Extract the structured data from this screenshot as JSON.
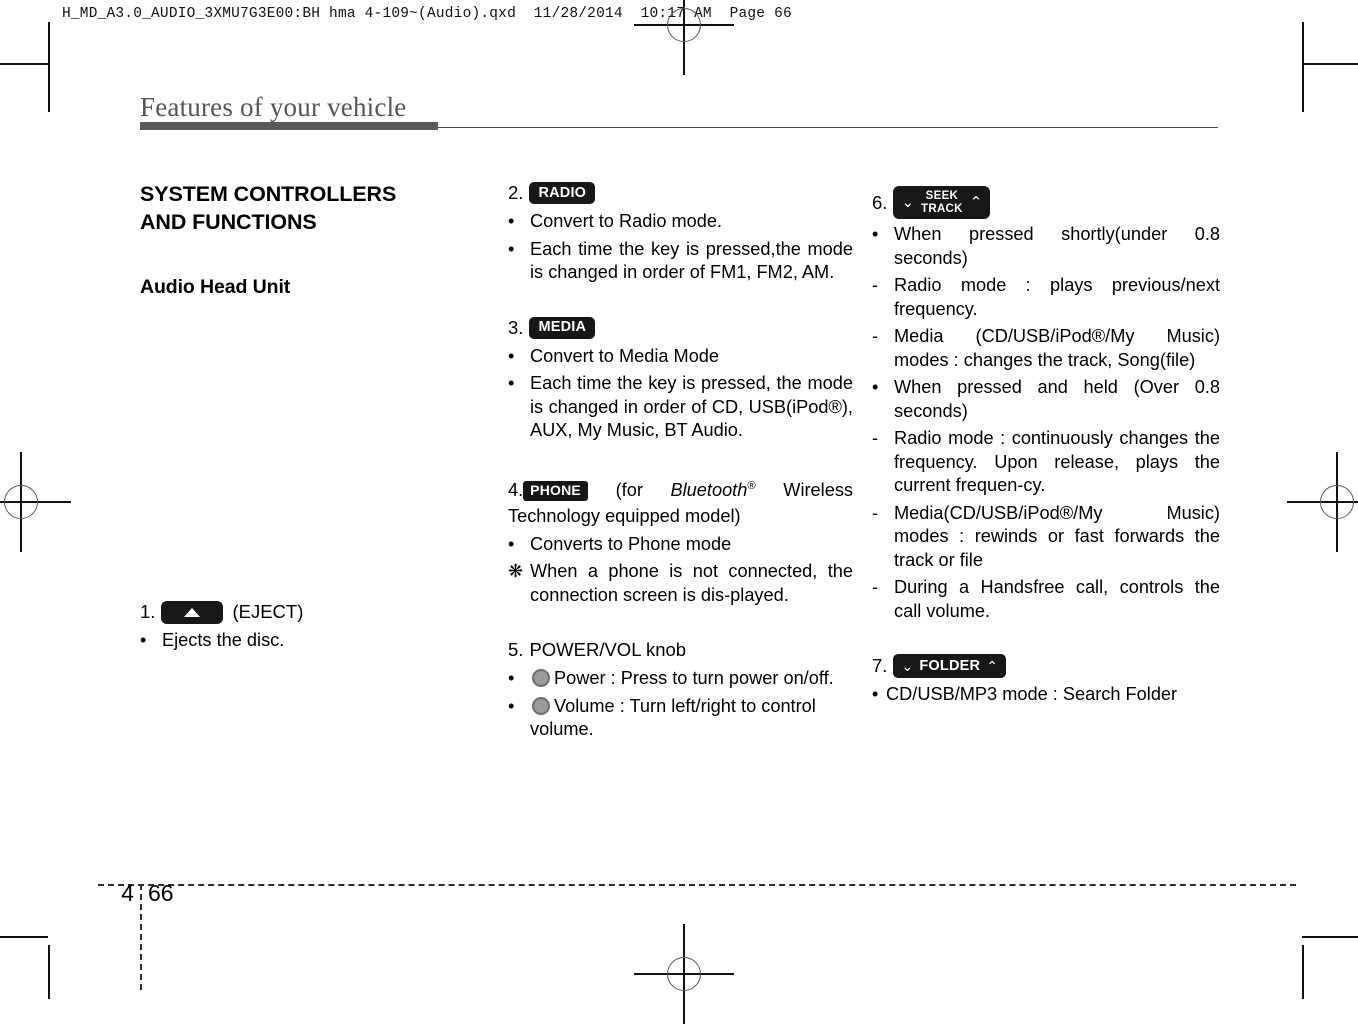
{
  "print": {
    "slug": "H_MD_A3.0_AUDIO_3XMU7G3E00:BH hma 4-109~(Audio).qxd  11/28/2014  10:17 AM  Page 66"
  },
  "page": {
    "running_head": "Features of your vehicle",
    "chapter_number": "4",
    "page_number": "66"
  },
  "left": {
    "section_title_line1": "SYSTEM CONTROLLERS",
    "section_title_line2": "AND FUNCTIONS",
    "subsection_title": "Audio Head Unit",
    "item1": {
      "number": "1.",
      "key_icon": "eject-triangle-icon",
      "label": "(EJECT)",
      "bullets": [
        {
          "mark": "•",
          "text": "Ejects the disc."
        }
      ]
    }
  },
  "middle": {
    "item2": {
      "number": "2.",
      "key": "RADIO",
      "bullets": [
        {
          "mark": "•",
          "text": "Convert to Radio mode."
        },
        {
          "mark": "•",
          "text": "Each time the key is pressed,the mode is changed in order of FM1, FM2, AM."
        }
      ]
    },
    "item3": {
      "number": "3.",
      "key": "MEDIA",
      "bullets": [
        {
          "mark": "•",
          "text": "Convert to Media Mode"
        },
        {
          "mark": "•",
          "text": "Each time the key is pressed, the mode is changed in order of CD, USB(iPod®), AUX, My Music, BT Audio."
        }
      ]
    },
    "item4": {
      "number": "4.",
      "key": "PHONE",
      "qualifier_pre": "(for ",
      "qualifier_italic": "Bluetooth",
      "qualifier_sup": "®",
      "qualifier_post": " Wireless Technology equipped model)",
      "bullets": [
        {
          "mark": "•",
          "text": "Converts to Phone mode"
        },
        {
          "mark": "❋",
          "text": "When a phone is not connected, the connection screen is dis-played."
        }
      ]
    },
    "item5": {
      "number": "5.",
      "label": "POWER/VOL knob",
      "bullets": [
        {
          "mark": "•",
          "icon": "knob-icon",
          "text": "Power : Press to turn power on/off."
        },
        {
          "mark": "•",
          "icon": "knob-icon",
          "text": "Volume : Turn left/right to control volume."
        }
      ]
    }
  },
  "right": {
    "item6": {
      "number": "6.",
      "key_chevron_left": "⌄",
      "key_line1": "SEEK",
      "key_line2": "TRACK",
      "key_chevron_right": "⌃",
      "bullets": [
        {
          "mark": "•",
          "text": "When pressed shortly(under 0.8 seconds)"
        },
        {
          "mark": "-",
          "text": "Radio mode : plays previous/next frequency."
        },
        {
          "mark": "-",
          "text": "Media (CD/USB/iPod®/My Music) modes : changes the track, Song(file)"
        },
        {
          "mark": "•",
          "text": "When pressed and held (Over 0.8 seconds)"
        },
        {
          "mark": "-",
          "text": "Radio mode : continuously changes the frequency. Upon release, plays the current frequen-cy."
        },
        {
          "mark": "-",
          "text": "Media(CD/USB/iPod®/My Music) modes : rewinds or fast forwards the track or file"
        },
        {
          "mark": "-",
          "text": "During a Handsfree call, controls the call volume."
        }
      ]
    },
    "item7": {
      "number": "7.",
      "key_chevron_left": "⌄",
      "key_label": "FOLDER",
      "key_chevron_right": "⌃",
      "bullets": [
        {
          "mark": "•",
          "text": "CD/USB/MP3 mode : Search Folder"
        }
      ]
    }
  }
}
